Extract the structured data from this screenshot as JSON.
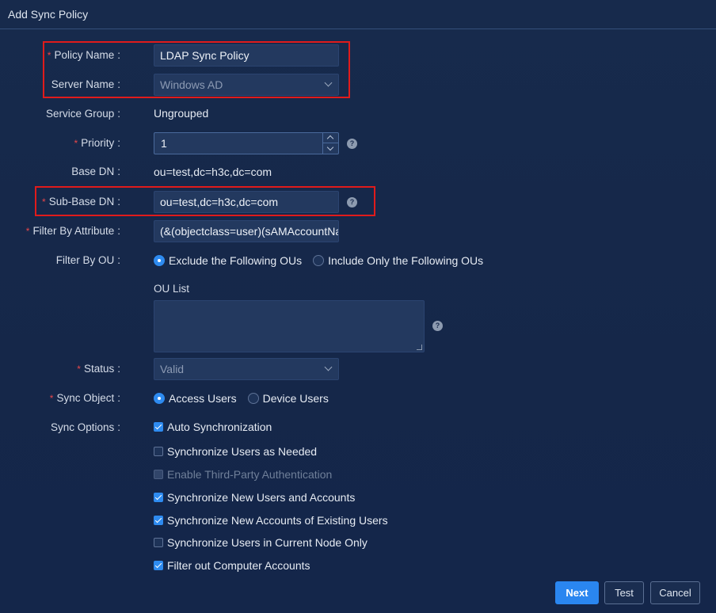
{
  "dialog": {
    "title": "Add Sync Policy"
  },
  "form": {
    "policy_name": {
      "label": "Policy Name",
      "value": "LDAP Sync Policy"
    },
    "server_name": {
      "label": "Server Name",
      "value": "Windows AD"
    },
    "service_group": {
      "label": "Service Group",
      "value": "Ungrouped"
    },
    "priority": {
      "label": "Priority",
      "value": "1"
    },
    "base_dn": {
      "label": "Base DN",
      "value": "ou=test,dc=h3c,dc=com"
    },
    "sub_base_dn": {
      "label": "Sub-Base DN",
      "value": "ou=test,dc=h3c,dc=com"
    },
    "filter_attr": {
      "label": "Filter By Attribute",
      "value": "(&(objectclass=user)(sAMAccountNa"
    },
    "filter_ou": {
      "label": "Filter By OU",
      "options": [
        "Exclude the Following OUs",
        "Include Only the Following OUs"
      ],
      "selected": 0,
      "ou_list_label": "OU List"
    },
    "status": {
      "label": "Status",
      "value": "Valid"
    },
    "sync_object": {
      "label": "Sync Object",
      "options": [
        "Access Users",
        "Device Users"
      ],
      "selected": 0
    },
    "sync_options": {
      "label": "Sync Options",
      "items": [
        {
          "label": "Auto Synchronization",
          "checked": true,
          "disabled": false
        },
        {
          "label": "Synchronize Users as Needed",
          "checked": false,
          "disabled": false
        },
        {
          "label": "Enable Third-Party Authentication",
          "checked": false,
          "disabled": true
        },
        {
          "label": "Synchronize New Users and Accounts",
          "checked": true,
          "disabled": false
        },
        {
          "label": "Synchronize New Accounts of Existing Users",
          "checked": true,
          "disabled": false
        },
        {
          "label": "Synchronize Users in Current Node Only",
          "checked": false,
          "disabled": false
        },
        {
          "label": "Filter out Computer Accounts",
          "checked": true,
          "disabled": false
        }
      ]
    },
    "colon": ":",
    "required_mark": "*",
    "help_glyph": "?"
  },
  "buttons": {
    "next": "Next",
    "test": "Test",
    "cancel": "Cancel"
  },
  "colors": {
    "accent": "#2a86f0",
    "highlight": "#e01b1b",
    "required": "#e8474a",
    "background": "#16284a"
  }
}
